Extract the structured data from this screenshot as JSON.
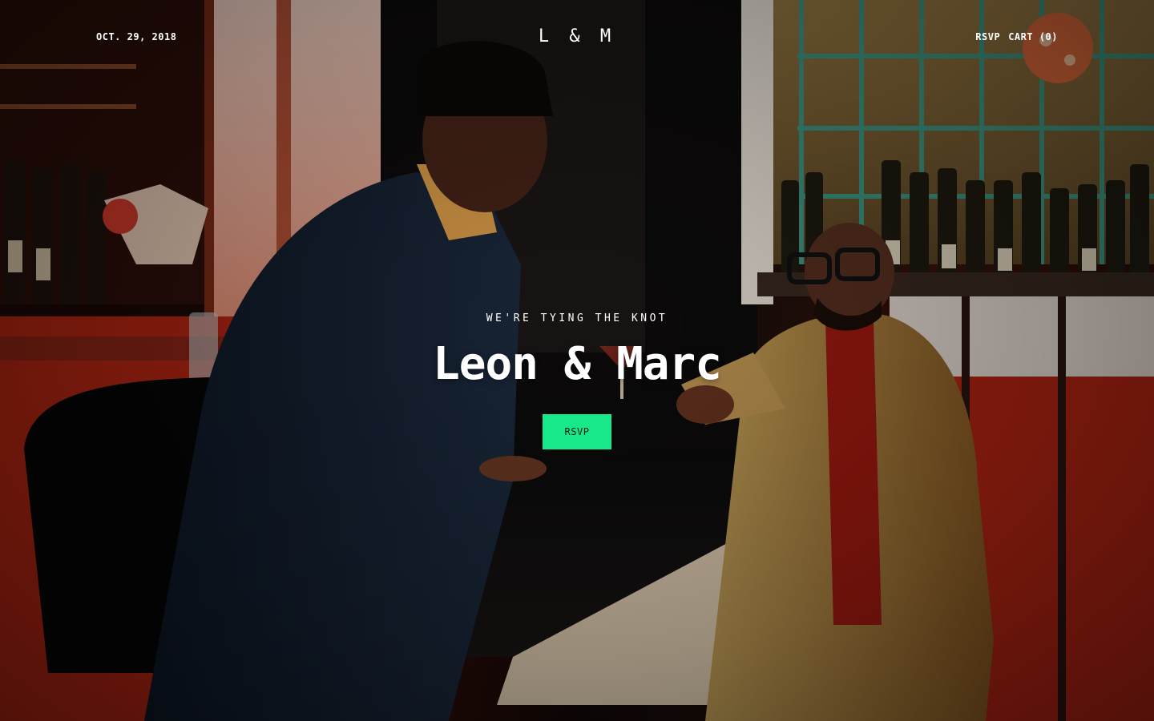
{
  "header": {
    "date": "OCT. 29, 2018",
    "logo": "L & M",
    "nav": {
      "rsvp": "RSVP",
      "cart": "CART (0)"
    }
  },
  "hero": {
    "kicker": "WE'RE TYING THE KNOT",
    "title": "Leon & Marc",
    "cta": "RSVP"
  },
  "colors": {
    "accent": "#17e88a",
    "text": "#ffffff"
  }
}
